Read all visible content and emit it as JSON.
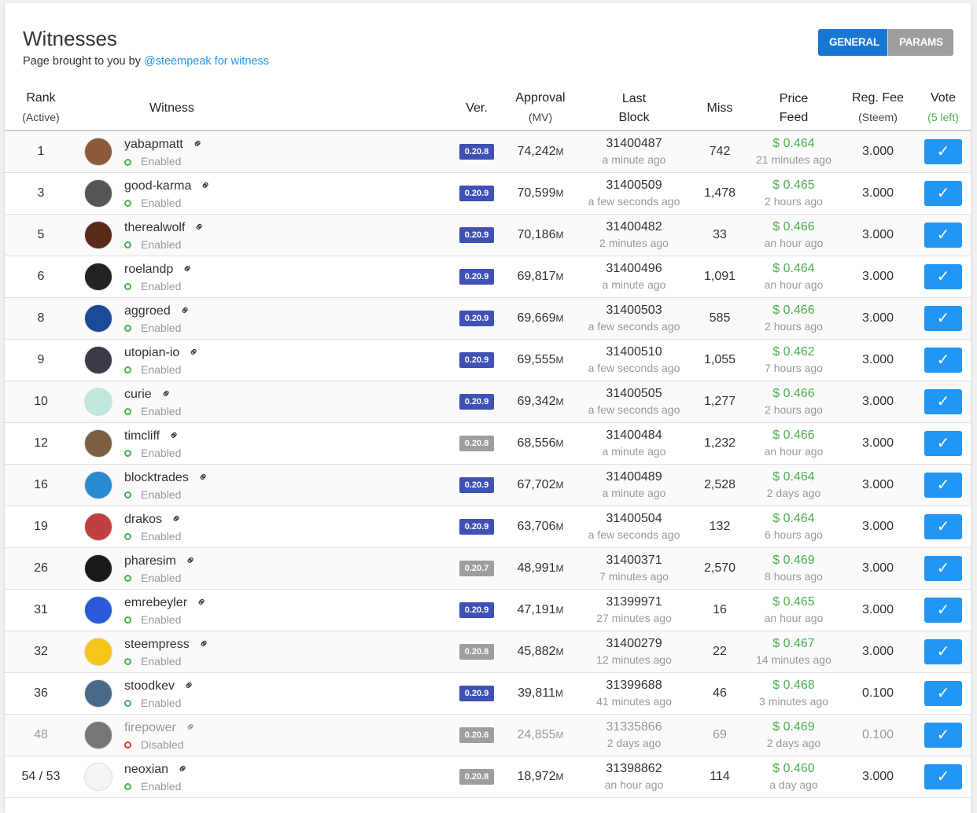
{
  "title": "Witnesses",
  "subtitle": "Page brought to you by ",
  "subtitle_link": "@steempeak for witness",
  "tabs": {
    "general": "GENERAL",
    "params": "PARAMS"
  },
  "headers": {
    "rank": "Rank",
    "rank_sub": "(Active)",
    "witness": "Witness",
    "ver": "Ver.",
    "approval": "Approval",
    "approval_sub": "(MV)",
    "last": "Last",
    "block": "Block",
    "miss": "Miss",
    "price": "Price",
    "feed": "Feed",
    "fee": "Reg. Fee",
    "fee_sub": "(Steem)",
    "vote": "Vote",
    "vote_sub": "(5 left)"
  },
  "colors": {
    "accent": "#2196f3",
    "version_current": "#3f51b5",
    "version_old": "#9e9e9e",
    "enabled": "#4caf50",
    "disabled": "#e53935"
  },
  "rows": [
    {
      "rank": "1",
      "name": "yabapmatt",
      "status": "Enabled",
      "ver": "0.20.8",
      "vc": "b",
      "approval": "74,242",
      "unit": "M",
      "block": "31400487",
      "block_ago": "a minute ago",
      "miss": "742",
      "price": "$ 0.464",
      "price_ago": "21 minutes ago",
      "fee": "3.000",
      "av": "#8d5a3b"
    },
    {
      "rank": "3",
      "name": "good-karma",
      "status": "Enabled",
      "ver": "0.20.9",
      "vc": "b",
      "approval": "70,599",
      "unit": "M",
      "block": "31400509",
      "block_ago": "a few seconds ago",
      "miss": "1,478",
      "price": "$ 0.465",
      "price_ago": "2 hours ago",
      "fee": "3.000",
      "av": "#555"
    },
    {
      "rank": "5",
      "name": "therealwolf",
      "status": "Enabled",
      "ver": "0.20.9",
      "vc": "b",
      "approval": "70,186",
      "unit": "M",
      "block": "31400482",
      "block_ago": "2 minutes ago",
      "miss": "33",
      "price": "$ 0.466",
      "price_ago": "an hour ago",
      "fee": "3.000",
      "av": "#5a2a1a"
    },
    {
      "rank": "6",
      "name": "roelandp",
      "status": "Enabled",
      "ver": "0.20.9",
      "vc": "b",
      "approval": "69,817",
      "unit": "M",
      "block": "31400496",
      "block_ago": "a minute ago",
      "miss": "1,091",
      "price": "$ 0.464",
      "price_ago": "an hour ago",
      "fee": "3.000",
      "av": "#222"
    },
    {
      "rank": "8",
      "name": "aggroed",
      "status": "Enabled",
      "ver": "0.20.9",
      "vc": "b",
      "approval": "69,669",
      "unit": "M",
      "block": "31400503",
      "block_ago": "a few seconds ago",
      "miss": "585",
      "price": "$ 0.466",
      "price_ago": "2 hours ago",
      "fee": "3.000",
      "av": "#1a4a9a"
    },
    {
      "rank": "9",
      "name": "utopian-io",
      "status": "Enabled",
      "ver": "0.20.9",
      "vc": "b",
      "approval": "69,555",
      "unit": "M",
      "block": "31400510",
      "block_ago": "a few seconds ago",
      "miss": "1,055",
      "price": "$ 0.462",
      "price_ago": "7 hours ago",
      "fee": "3.000",
      "av": "#3a3a4a"
    },
    {
      "rank": "10",
      "name": "curie",
      "status": "Enabled",
      "ver": "0.20.9",
      "vc": "b",
      "approval": "69,342",
      "unit": "M",
      "block": "31400505",
      "block_ago": "a few seconds ago",
      "miss": "1,277",
      "price": "$ 0.466",
      "price_ago": "2 hours ago",
      "fee": "3.000",
      "av": "#bfe8df"
    },
    {
      "rank": "12",
      "name": "timcliff",
      "status": "Enabled",
      "ver": "0.20.8",
      "vc": "g",
      "approval": "68,556",
      "unit": "M",
      "block": "31400484",
      "block_ago": "a minute ago",
      "miss": "1,232",
      "price": "$ 0.466",
      "price_ago": "an hour ago",
      "fee": "3.000",
      "av": "#7a6040"
    },
    {
      "rank": "16",
      "name": "blocktrades",
      "status": "Enabled",
      "ver": "0.20.9",
      "vc": "b",
      "approval": "67,702",
      "unit": "M",
      "block": "31400489",
      "block_ago": "a minute ago",
      "miss": "2,528",
      "price": "$ 0.464",
      "price_ago": "2 days ago",
      "fee": "3.000",
      "av": "#2a8ad0"
    },
    {
      "rank": "19",
      "name": "drakos",
      "status": "Enabled",
      "ver": "0.20.9",
      "vc": "b",
      "approval": "63,706",
      "unit": "M",
      "block": "31400504",
      "block_ago": "a few seconds ago",
      "miss": "132",
      "price": "$ 0.464",
      "price_ago": "6 hours ago",
      "fee": "3.000",
      "av": "#c04040"
    },
    {
      "rank": "26",
      "name": "pharesim",
      "status": "Enabled",
      "ver": "0.20.7",
      "vc": "g",
      "approval": "48,991",
      "unit": "M",
      "block": "31400371",
      "block_ago": "7 minutes ago",
      "miss": "2,570",
      "price": "$ 0.469",
      "price_ago": "8 hours ago",
      "fee": "3.000",
      "av": "#1a1a1a"
    },
    {
      "rank": "31",
      "name": "emrebeyler",
      "status": "Enabled",
      "ver": "0.20.9",
      "vc": "b",
      "approval": "47,191",
      "unit": "M",
      "block": "31399971",
      "block_ago": "27 minutes ago",
      "miss": "16",
      "price": "$ 0.465",
      "price_ago": "an hour ago",
      "fee": "3.000",
      "av": "#2a5ad8"
    },
    {
      "rank": "32",
      "name": "steempress",
      "status": "Enabled",
      "ver": "0.20.8",
      "vc": "g",
      "approval": "45,882",
      "unit": "M",
      "block": "31400279",
      "block_ago": "12 minutes ago",
      "miss": "22",
      "price": "$ 0.467",
      "price_ago": "14 minutes ago",
      "fee": "3.000",
      "av": "#f5c518"
    },
    {
      "rank": "36",
      "name": "stoodkev",
      "status": "Enabled",
      "ver": "0.20.9",
      "vc": "b",
      "approval": "39,811",
      "unit": "M",
      "block": "31399688",
      "block_ago": "41 minutes ago",
      "miss": "46",
      "price": "$ 0.468",
      "price_ago": "3 minutes ago",
      "fee": "0.100",
      "av": "#4a6a8a"
    },
    {
      "rank": "48",
      "name": "firepower",
      "status": "Disabled",
      "ver": "0.20.6",
      "vc": "g",
      "approval": "24,855",
      "unit": "M",
      "block": "31335866",
      "block_ago": "2 days ago",
      "miss": "69",
      "price": "$ 0.469",
      "price_ago": "2 days ago",
      "fee": "0.100",
      "av": "#777",
      "dis": true
    },
    {
      "rank": "54 / 53",
      "name": "neoxian",
      "status": "Enabled",
      "ver": "0.20.8",
      "vc": "g",
      "approval": "18,972",
      "unit": "M",
      "block": "31398862",
      "block_ago": "an hour ago",
      "miss": "114",
      "price": "$ 0.460",
      "price_ago": "a day ago",
      "fee": "3.000",
      "av": "#f4f4f4"
    }
  ]
}
